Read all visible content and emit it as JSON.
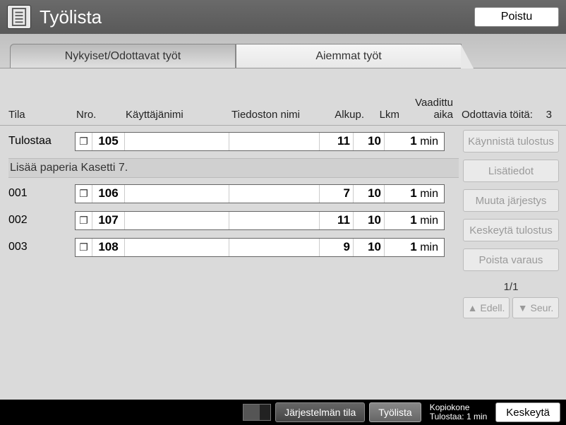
{
  "titlebar": {
    "title": "Työlista",
    "exit": "Poistu"
  },
  "tabs": {
    "current": "Nykyiset/Odottavat työt",
    "past": "Aiemmat työt"
  },
  "columns": {
    "status": "Tila",
    "nro": "Nro.",
    "user": "Käyttäjänimi",
    "file": "Tiedoston nimi",
    "orig": "Alkup.",
    "count": "Lkm",
    "time": "Vaadittu aika"
  },
  "waiting": {
    "label": "Odottavia töitä:",
    "count": "3"
  },
  "printing_row": {
    "status": "Tulostaa",
    "nro": "105",
    "alku": "11",
    "lkm": "10",
    "time_num": "1",
    "time_unit": "min"
  },
  "message": "Lisää paperia Kasetti 7.",
  "queue": [
    {
      "status": "001",
      "nro": "106",
      "alku": "7",
      "lkm": "10",
      "time_num": "1",
      "time_unit": "min"
    },
    {
      "status": "002",
      "nro": "107",
      "alku": "11",
      "lkm": "10",
      "time_num": "1",
      "time_unit": "min"
    },
    {
      "status": "003",
      "nro": "108",
      "alku": "9",
      "lkm": "10",
      "time_num": "1",
      "time_unit": "min"
    }
  ],
  "sidebar": {
    "start": "Käynnistä tulostus",
    "details": "Lisätiedot",
    "reorder": "Muuta järjestys",
    "pause": "Keskeytä tulostus",
    "delete": "Poista varaus"
  },
  "pager": {
    "pos": "1/1",
    "prev": "▲  Edell.",
    "next": "▼  Seur."
  },
  "footer": {
    "sysstatus": "Järjestelmän tila",
    "joblist": "Työlista",
    "line1": "Kopiokone",
    "line2": "Tulostaa: 1 min",
    "interrupt": "Keskeytä"
  }
}
